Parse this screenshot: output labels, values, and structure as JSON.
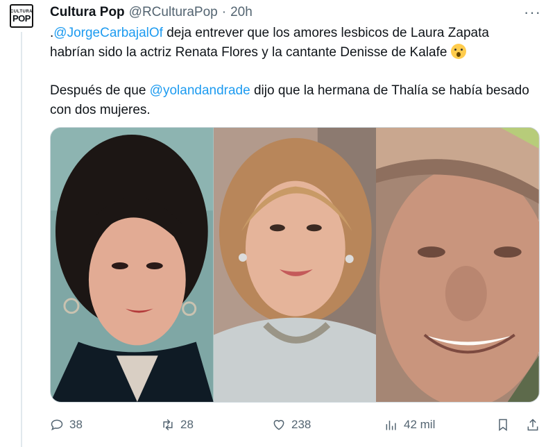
{
  "tweet": {
    "avatar_lines": [
      "CULTURA",
      "POP"
    ],
    "author_name": "Cultura Pop",
    "author_handle": "@RCulturaPop",
    "separator": "·",
    "time": "20h",
    "more_label": "···",
    "paragraph1": {
      "prefix": ".",
      "mention": "@JorgeCarbajalOf",
      "text": " deja entrever que los amores lesbicos de Laura Zapata habrían sido la actriz Renata Flores y la cantante Denisse de Kalafe",
      "emoji": "scream-emoji"
    },
    "paragraph2": {
      "prefix": "Después de que ",
      "mention": "@yolandandrade",
      "text": " dijo que la hermana de Thalía se había besado con dos mujeres."
    },
    "media": [
      {
        "name": "photo-woman-dark-hair",
        "background": "#7fa7a5"
      },
      {
        "name": "photo-woman-blonde",
        "background": "#9a8578"
      },
      {
        "name": "photo-woman-hat",
        "background": "#8f7160"
      }
    ]
  },
  "actions": {
    "reply": {
      "icon": "reply-icon",
      "count": "38"
    },
    "retweet": {
      "icon": "retweet-icon",
      "count": "28"
    },
    "like": {
      "icon": "heart-icon",
      "count": "238"
    },
    "views": {
      "icon": "views-icon",
      "count": "42 mil"
    },
    "bookmark": {
      "icon": "bookmark-icon"
    },
    "share": {
      "icon": "share-icon"
    }
  },
  "colors": {
    "link": "#1d9bf0",
    "muted": "#536471",
    "text": "#0f1419"
  }
}
